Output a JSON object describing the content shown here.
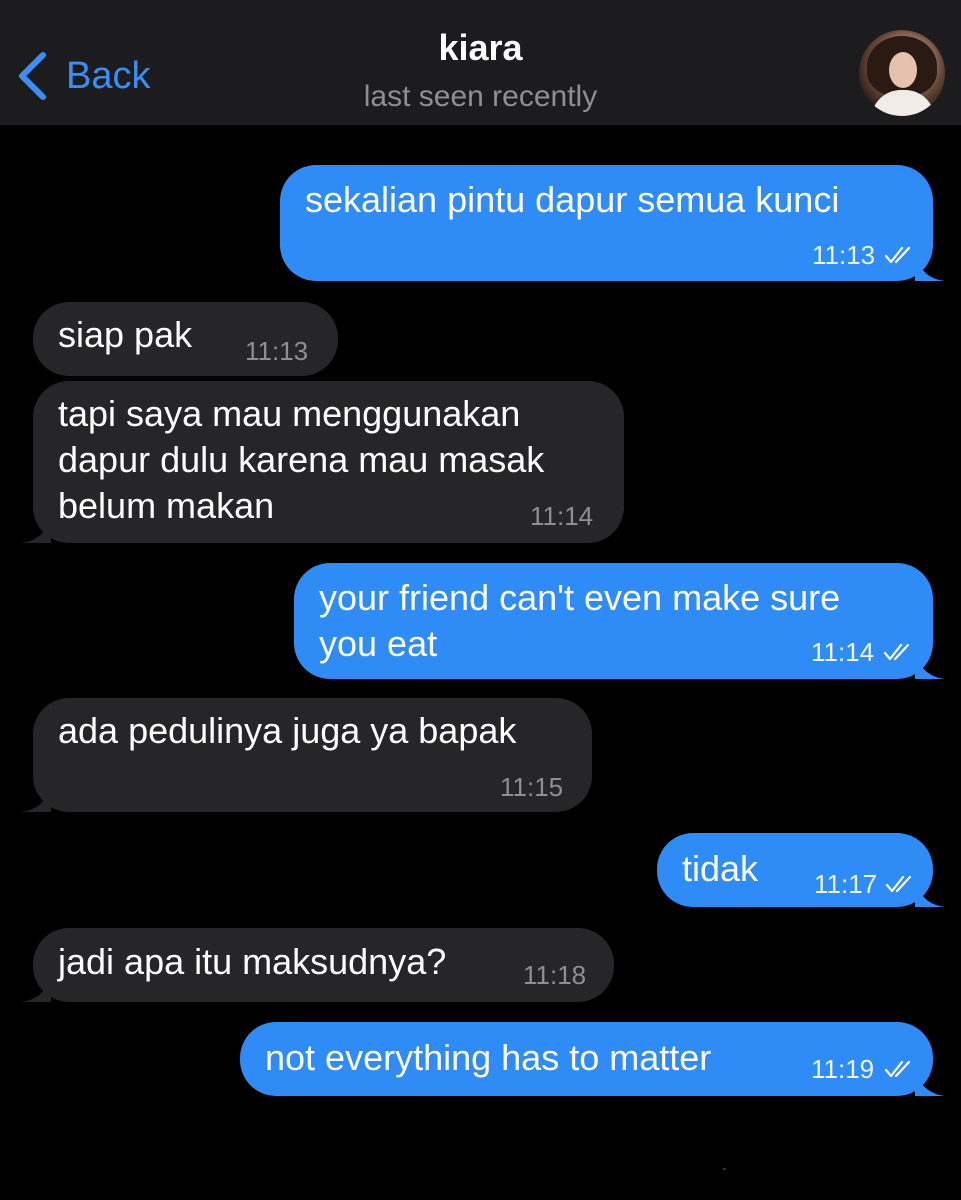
{
  "header": {
    "back_label": "Back",
    "contact_name": "kiara",
    "status": "last seen recently",
    "back_icon": "chevron-left-icon",
    "avatar_icon": "contact-avatar"
  },
  "colors": {
    "header_bg": "#1c1c1e",
    "accent": "#3a8ef6",
    "outgoing_bubble": "#2f8cf6",
    "incoming_bubble": "#262628",
    "background": "#000000"
  },
  "messages": [
    {
      "direction": "out",
      "text": "sekalian pintu dapur semua kunci",
      "time": "11:13",
      "read": true
    },
    {
      "direction": "in",
      "text": "siap pak",
      "time": "11:13"
    },
    {
      "direction": "in",
      "text": "tapi saya mau menggunakan\ndapur dulu karena mau masak\nbelum makan",
      "time": "11:14"
    },
    {
      "direction": "out",
      "text": "your friend can't even make sure\nyou eat",
      "time": "11:14",
      "read": true
    },
    {
      "direction": "in",
      "text": "ada pedulinya juga ya bapak",
      "time": "11:15"
    },
    {
      "direction": "out",
      "text": "tidak",
      "time": "11:17",
      "read": true
    },
    {
      "direction": "in",
      "text": "jadi apa itu maksudnya?",
      "time": "11:18"
    },
    {
      "direction": "out",
      "text": "not everything has to matter",
      "time": "11:19",
      "read": true
    }
  ]
}
